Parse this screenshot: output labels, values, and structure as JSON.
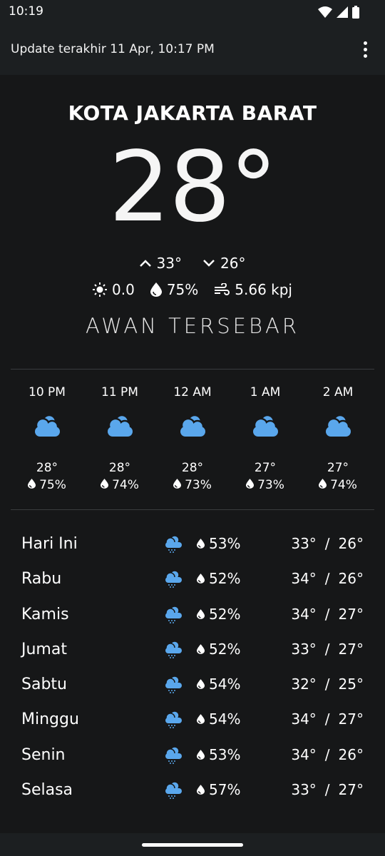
{
  "status_bar": {
    "time": "10:19"
  },
  "app_bar": {
    "update_text": "Update terakhir 11 Apr, 10:17 PM"
  },
  "current": {
    "city": "KOTA JAKARTA BARAT",
    "temperature": "28°",
    "high": "33°",
    "low": "26°",
    "uv": "0.0",
    "humidity": "75%",
    "wind": "5.66 kpj",
    "description": "AWAN TERSEBAR"
  },
  "hourly": [
    {
      "time": "10 PM",
      "temp": "28°",
      "humidity": "75%",
      "icon": "cloud-icon"
    },
    {
      "time": "11 PM",
      "temp": "28°",
      "humidity": "74%",
      "icon": "cloud-icon"
    },
    {
      "time": "12 AM",
      "temp": "28°",
      "humidity": "73%",
      "icon": "cloud-icon"
    },
    {
      "time": "1 AM",
      "temp": "27°",
      "humidity": "73%",
      "icon": "cloud-icon"
    },
    {
      "time": "2 AM",
      "temp": "27°",
      "humidity": "74%",
      "icon": "cloud-icon"
    }
  ],
  "daily": [
    {
      "day": "Hari Ini",
      "humidity": "53%",
      "high": "33°",
      "low": "26°",
      "icon": "rain-cloud-icon"
    },
    {
      "day": "Rabu",
      "humidity": "52%",
      "high": "34°",
      "low": "26°",
      "icon": "rain-cloud-icon"
    },
    {
      "day": "Kamis",
      "humidity": "52%",
      "high": "34°",
      "low": "27°",
      "icon": "rain-cloud-icon"
    },
    {
      "day": "Jumat",
      "humidity": "52%",
      "high": "33°",
      "low": "27°",
      "icon": "rain-cloud-icon"
    },
    {
      "day": "Sabtu",
      "humidity": "54%",
      "high": "32°",
      "low": "25°",
      "icon": "rain-cloud-icon"
    },
    {
      "day": "Minggu",
      "humidity": "54%",
      "high": "34°",
      "low": "27°",
      "icon": "rain-cloud-icon"
    },
    {
      "day": "Senin",
      "humidity": "53%",
      "high": "34°",
      "low": "26°",
      "icon": "rain-cloud-icon"
    },
    {
      "day": "Selasa",
      "humidity": "57%",
      "high": "33°",
      "low": "27°",
      "icon": "rain-cloud-icon"
    }
  ],
  "separator": "/",
  "colors": {
    "background": "#161718",
    "bar": "#1c1f21",
    "icon_blue": "#5aa7ec",
    "text": "#ffffff"
  }
}
